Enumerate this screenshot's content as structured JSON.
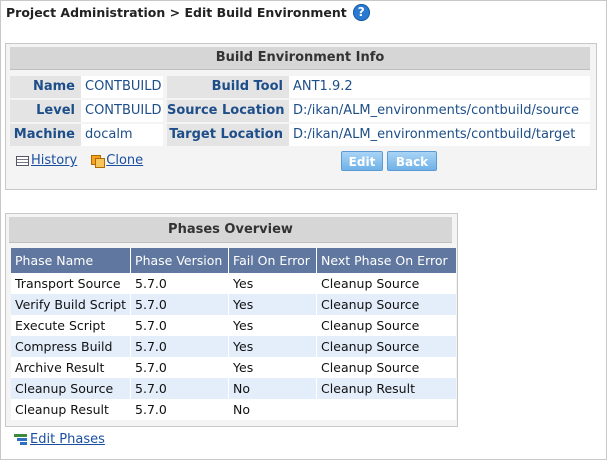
{
  "page": {
    "title": "Project Administration > Edit Build Environment",
    "help_glyph": "?"
  },
  "info": {
    "header": "Build Environment Info",
    "rows": [
      {
        "label1": "Name",
        "value1": "CONTBUILD",
        "label2": "Build Tool",
        "value2": "ANT1.9.2"
      },
      {
        "label1": "Level",
        "value1": "CONTBUILD",
        "label2": "Source Location",
        "value2": "D:/ikan/ALM_environments/contbuild/source"
      },
      {
        "label1": "Machine",
        "value1": "docalm",
        "label2": "Target Location",
        "value2": "D:/ikan/ALM_environments/contbuild/target"
      }
    ],
    "history_link": "History",
    "clone_link": "Clone",
    "edit_button": "Edit",
    "back_button": "Back"
  },
  "phases": {
    "header": "Phases Overview",
    "columns": [
      "Phase Name",
      "Phase Version",
      "Fail On Error",
      "Next Phase On Error"
    ],
    "rows": [
      [
        "Transport Source",
        "5.7.0",
        "Yes",
        "Cleanup Source"
      ],
      [
        "Verify Build Script",
        "5.7.0",
        "Yes",
        "Cleanup Source"
      ],
      [
        "Execute Script",
        "5.7.0",
        "Yes",
        "Cleanup Source"
      ],
      [
        "Compress Build",
        "5.7.0",
        "Yes",
        "Cleanup Source"
      ],
      [
        "Archive Result",
        "5.7.0",
        "Yes",
        "Cleanup Source"
      ],
      [
        "Cleanup Source",
        "5.7.0",
        "No",
        "Cleanup Result"
      ],
      [
        "Cleanup Result",
        "5.7.0",
        "No",
        ""
      ]
    ],
    "edit_link": "Edit Phases"
  },
  "icons": {
    "help": "help-icon",
    "history": "history-icon",
    "clone": "clone-icon",
    "edit_phases": "edit-phases-icon"
  },
  "colors": {
    "label_text": "#1d4e89",
    "table_header": "#6077a0",
    "button": "#6fb1e8",
    "link": "#1a4fa0"
  }
}
